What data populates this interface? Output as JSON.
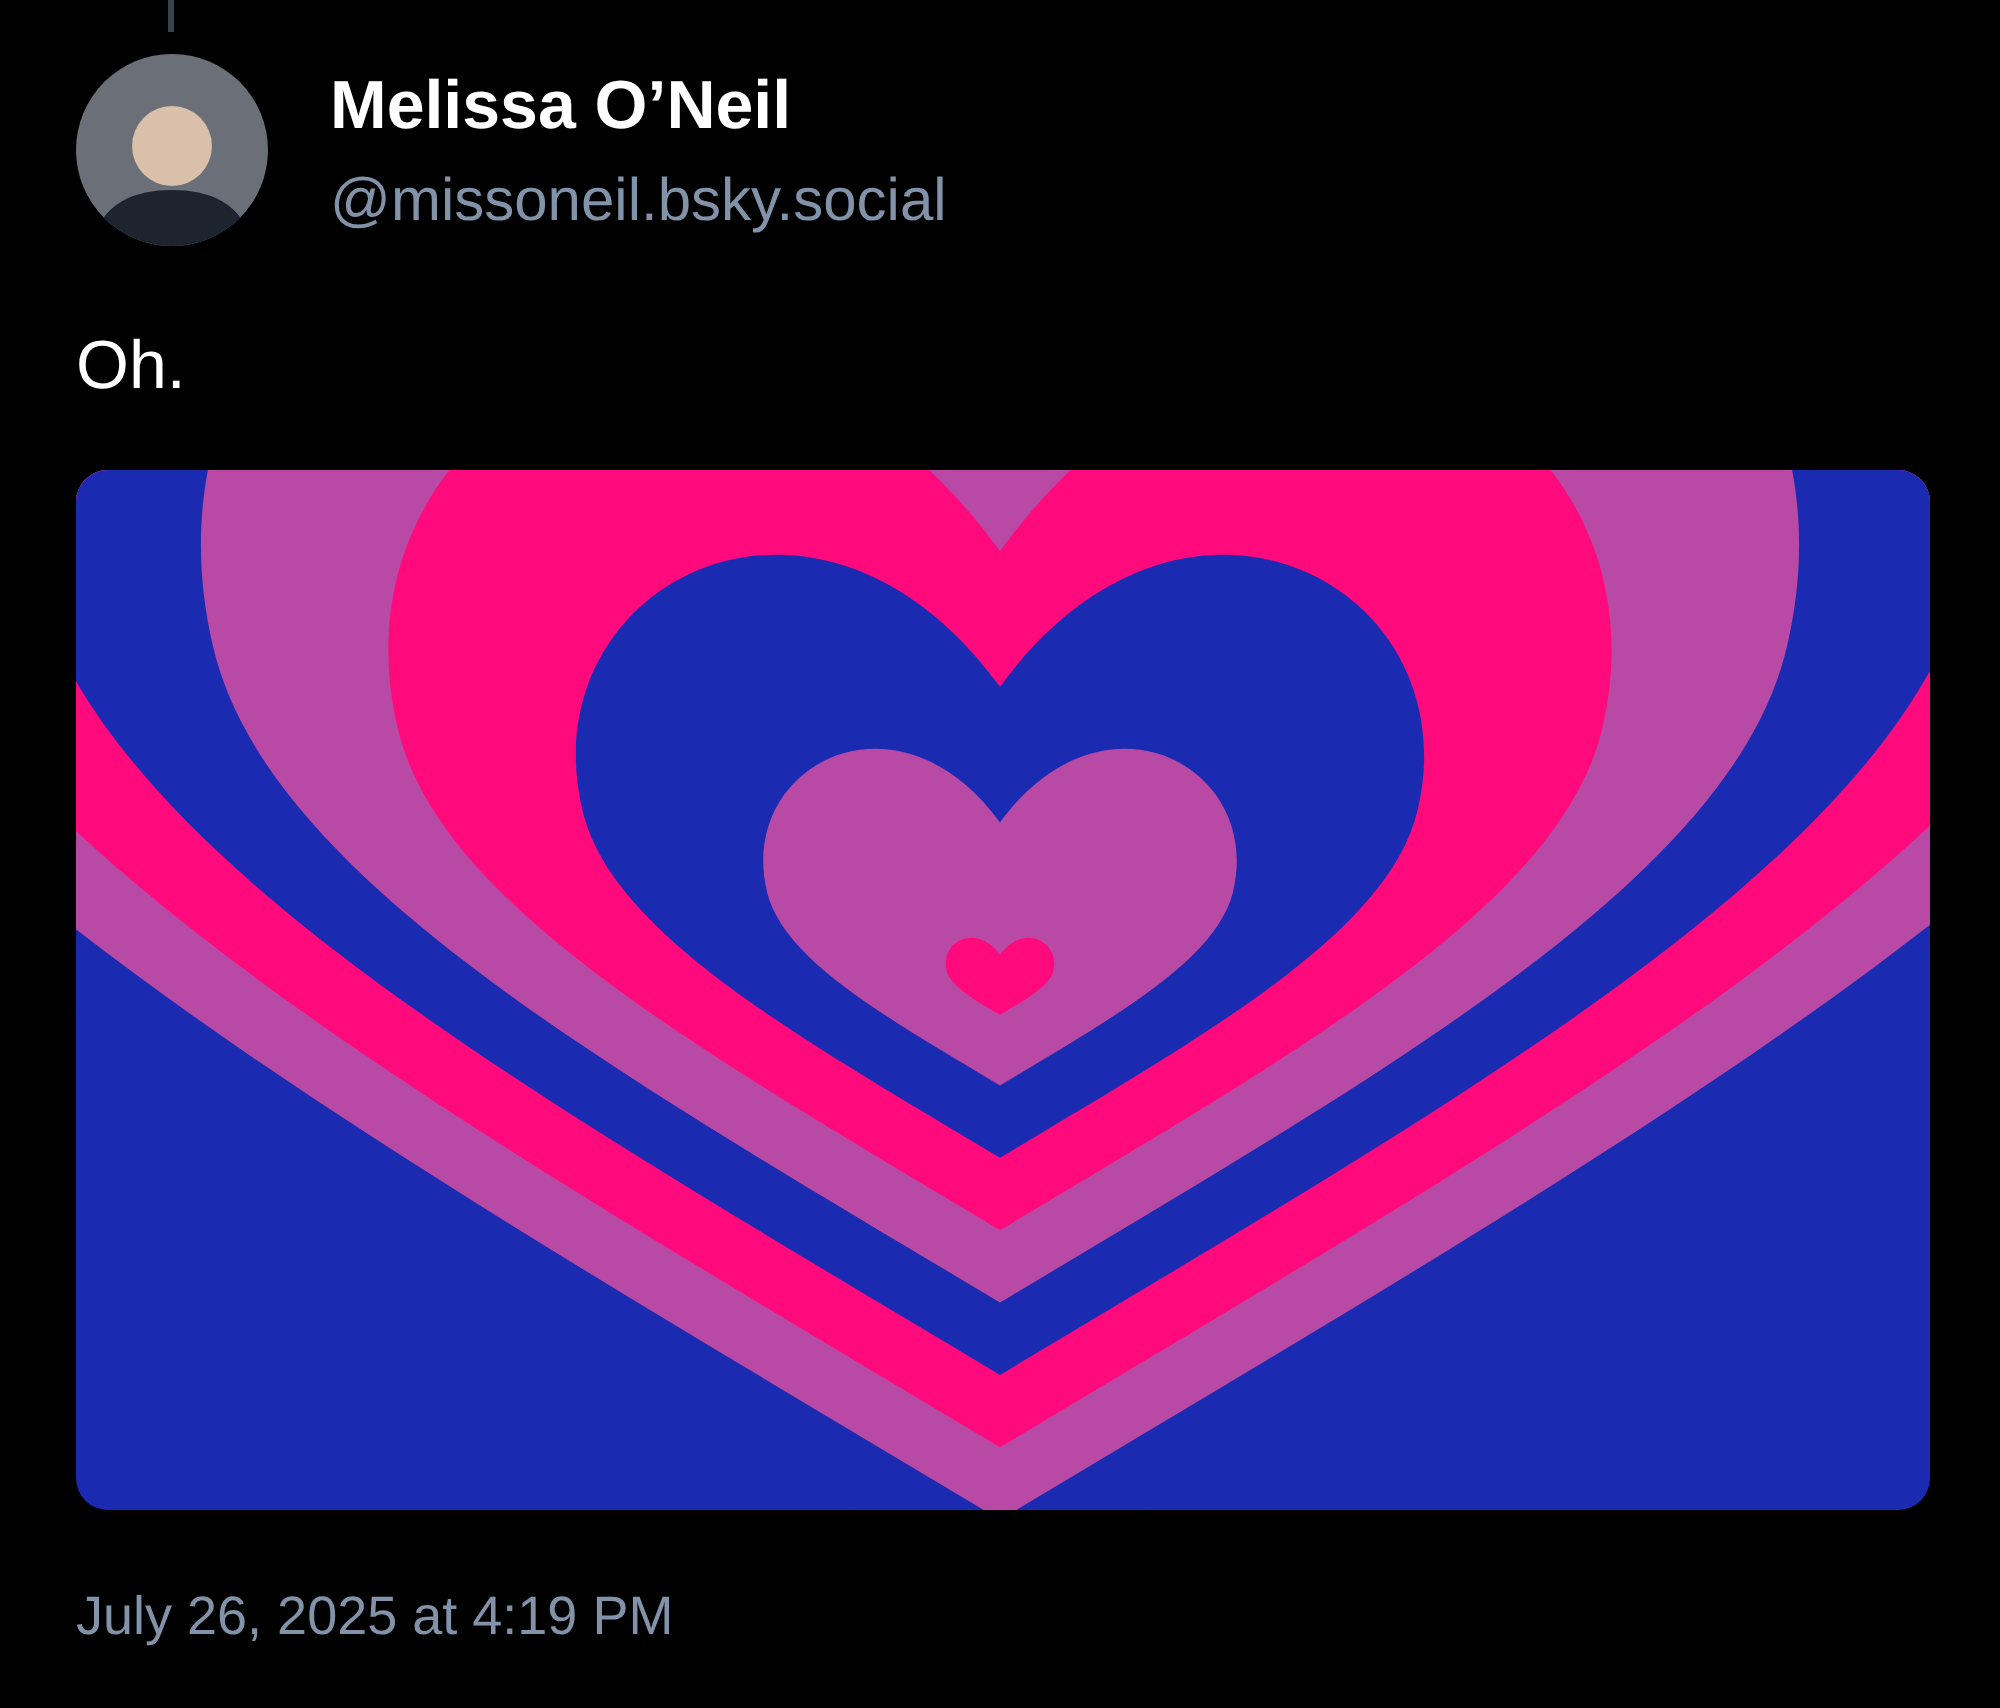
{
  "post": {
    "author_name": "Melissa O’Neil",
    "handle": "@missoneil.bsky.social",
    "text": "Oh.",
    "timestamp": "July 26, 2025 at 4:19 PM"
  }
}
